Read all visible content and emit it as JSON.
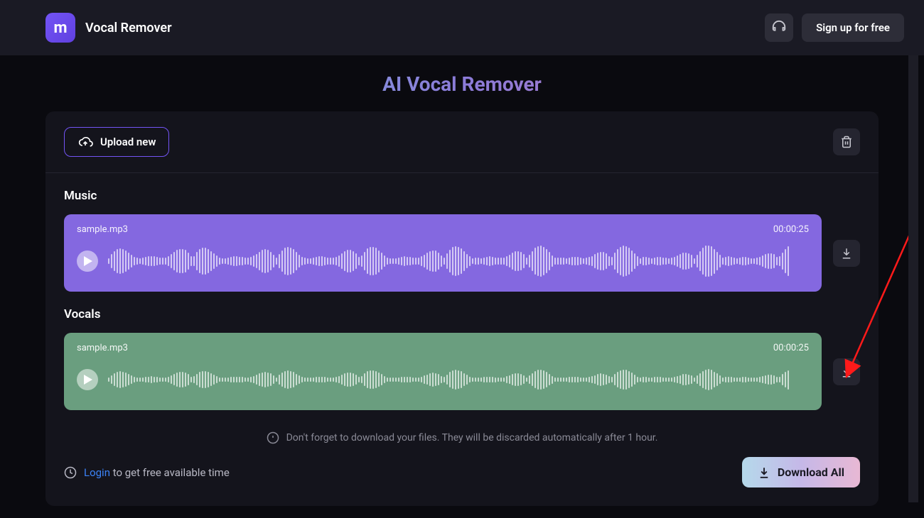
{
  "header": {
    "app_title": "Vocal Remover",
    "signup_label": "Sign up for free"
  },
  "page_title": "AI Vocal Remover",
  "toolbar": {
    "upload_label": "Upload new"
  },
  "tracks": {
    "music": {
      "section_title": "Music",
      "filename": "sample.mp3",
      "duration": "00:00:25"
    },
    "vocals": {
      "section_title": "Vocals",
      "filename": "sample.mp3",
      "duration": "00:00:25"
    }
  },
  "notice_text": "Don't forget to download your files. They will be discarded automatically after 1 hour.",
  "footer": {
    "login_label": "Login",
    "login_tail": " to get free available time",
    "download_all_label": "Download All"
  }
}
